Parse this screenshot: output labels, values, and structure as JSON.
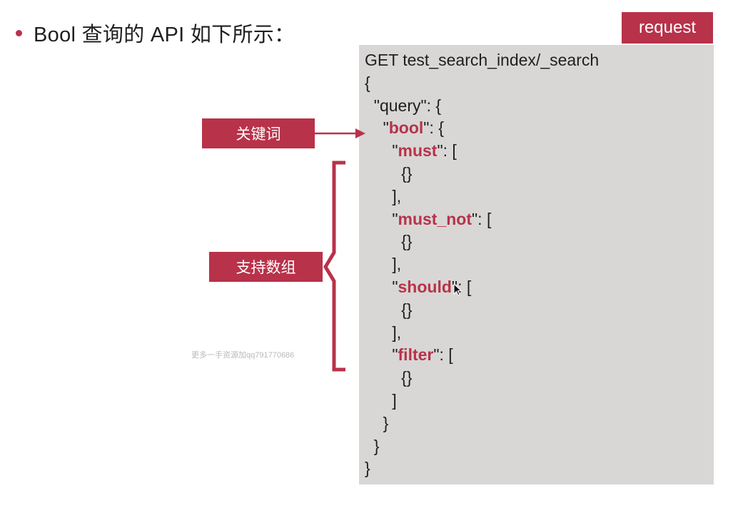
{
  "title": {
    "text": "Bool 查询的 API 如下所示："
  },
  "request_tab": {
    "label": "request"
  },
  "labels": {
    "keyword": "关键词",
    "supports_array": "支持数组"
  },
  "watermark": "更多一手资源加qq791770686",
  "code": {
    "lines": [
      {
        "indent": "",
        "pre": "GET test_search_index/_search",
        "kw": "",
        "post": ""
      },
      {
        "indent": "",
        "pre": "{",
        "kw": "",
        "post": ""
      },
      {
        "indent": "  ",
        "pre": "\"query\": {",
        "kw": "",
        "post": ""
      },
      {
        "indent": "    ",
        "pre": "\"",
        "kw": "bool",
        "post": "\": {"
      },
      {
        "indent": "      ",
        "pre": "\"",
        "kw": "must",
        "post": "\": ["
      },
      {
        "indent": "        ",
        "pre": "{}",
        "kw": "",
        "post": ""
      },
      {
        "indent": "      ",
        "pre": "],",
        "kw": "",
        "post": ""
      },
      {
        "indent": "      ",
        "pre": "\"",
        "kw": "must_not",
        "post": "\": ["
      },
      {
        "indent": "        ",
        "pre": "{}",
        "kw": "",
        "post": ""
      },
      {
        "indent": "      ",
        "pre": "],",
        "kw": "",
        "post": ""
      },
      {
        "indent": "      ",
        "pre": "\"",
        "kw": "should",
        "post": "\": ["
      },
      {
        "indent": "        ",
        "pre": "{}",
        "kw": "",
        "post": ""
      },
      {
        "indent": "      ",
        "pre": "],",
        "kw": "",
        "post": ""
      },
      {
        "indent": "      ",
        "pre": "\"",
        "kw": "filter",
        "post": "\": ["
      },
      {
        "indent": "        ",
        "pre": "{}",
        "kw": "",
        "post": ""
      },
      {
        "indent": "      ",
        "pre": "]",
        "kw": "",
        "post": ""
      },
      {
        "indent": "    ",
        "pre": "}",
        "kw": "",
        "post": ""
      },
      {
        "indent": "  ",
        "pre": "}",
        "kw": "",
        "post": ""
      },
      {
        "indent": "",
        "pre": "}",
        "kw": "",
        "post": ""
      }
    ]
  },
  "colors": {
    "accent": "#b8324a",
    "code_background": "#d8d7d6",
    "text": "#1f1f1f"
  },
  "icons": {
    "bullet": "bullet-dot-icon",
    "arrow": "arrow-right-icon",
    "brace": "curly-brace-icon",
    "cursor": "mouse-cursor-icon"
  }
}
